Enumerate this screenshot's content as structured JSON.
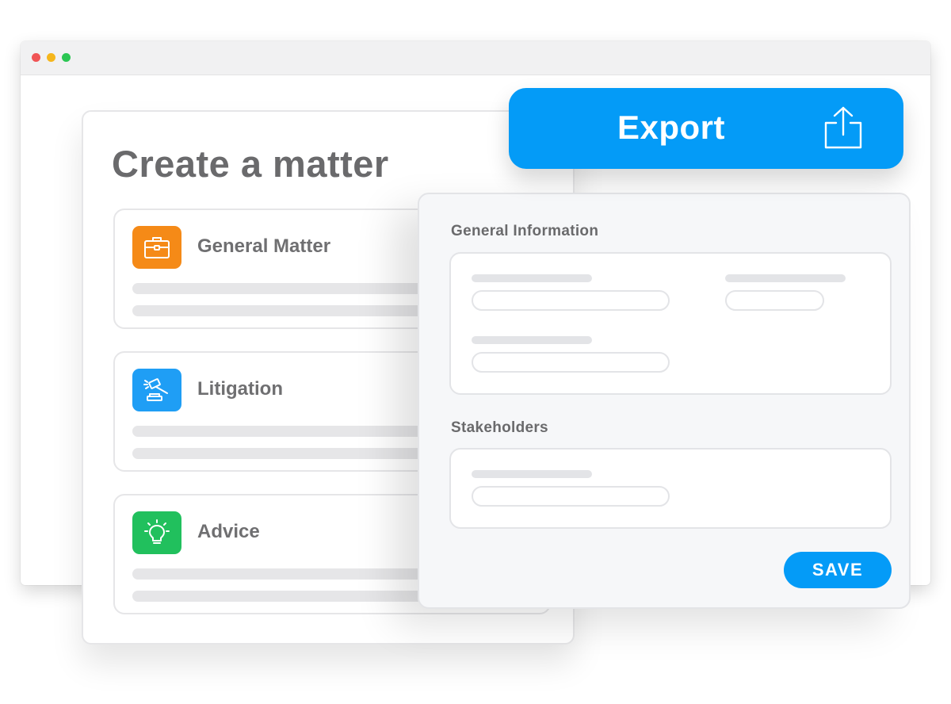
{
  "colors": {
    "accent": "#049bf7",
    "window_red": "#f05455",
    "window_yellow": "#f5b61c",
    "window_green": "#2bc653",
    "general_matter": "#f58a17",
    "litigation": "#1f9ef5",
    "advice": "#21c05d"
  },
  "matter_panel": {
    "title": "Create a matter",
    "options": [
      {
        "label": "General Matter",
        "icon": "briefcase-icon"
      },
      {
        "label": "Litigation",
        "icon": "gavel-icon"
      },
      {
        "label": "Advice",
        "icon": "lightbulb-icon"
      }
    ]
  },
  "form_panel": {
    "general_information_title": "General Information",
    "stakeholders_title": "Stakeholders",
    "save_label": "SAVE"
  },
  "export": {
    "label": "Export",
    "icon": "share-upload-icon"
  }
}
